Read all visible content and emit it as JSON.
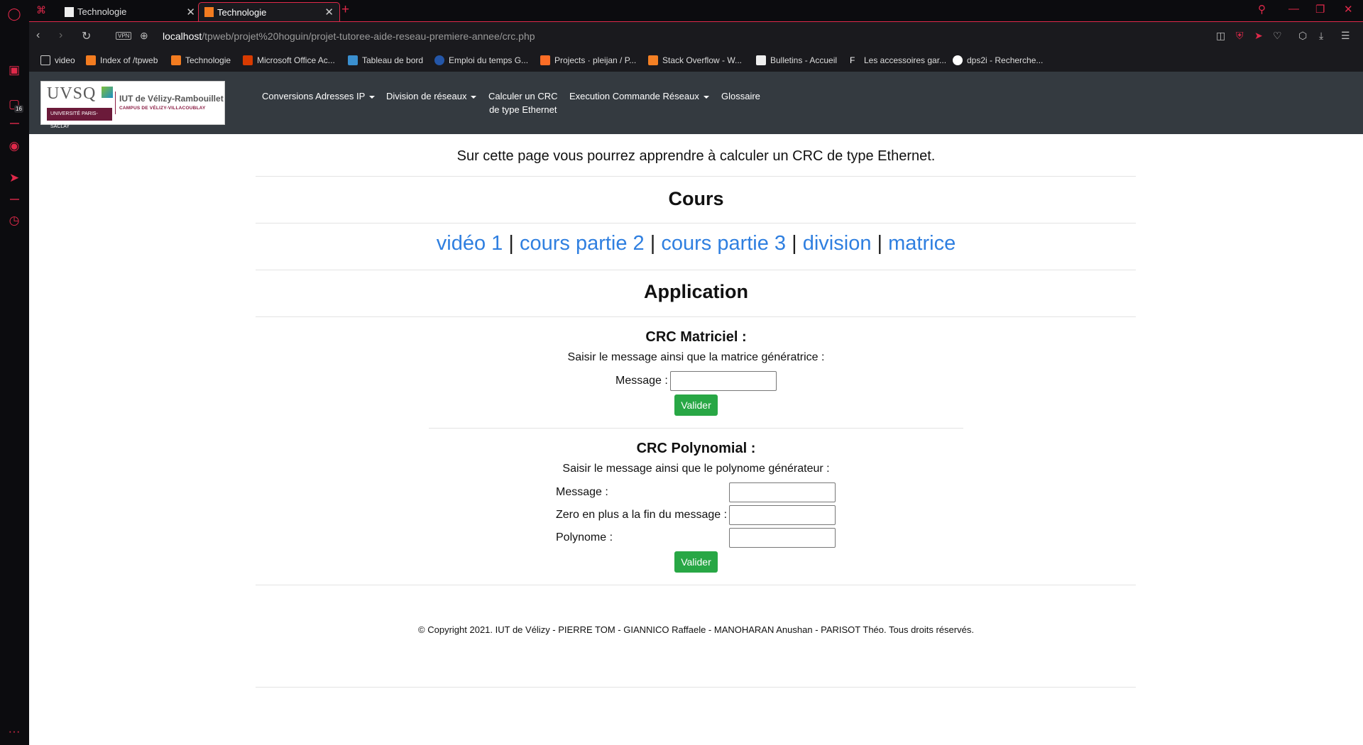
{
  "browser": {
    "tabs": [
      {
        "title": "Technologie",
        "active": false
      },
      {
        "title": "Technologie",
        "active": true
      }
    ],
    "url_host": "localhost",
    "url_path": "/tpweb/projet%20hoguin/projet-tutoree-aide-reseau-premiere-annee/crc.php",
    "vpn_label": "VPN",
    "sidebar_badge": "16",
    "bookmarks": [
      {
        "label": "video",
        "icon": "folder-icon"
      },
      {
        "label": "Index of /tpweb",
        "icon": "xampp-icon"
      },
      {
        "label": "Technologie",
        "icon": "xampp-icon"
      },
      {
        "label": "Microsoft Office Ac...",
        "icon": "office-icon"
      },
      {
        "label": "Tableau de bord",
        "icon": "dashboard-icon"
      },
      {
        "label": "Emploi du temps G...",
        "icon": "globe-icon"
      },
      {
        "label": "Projects · pleijan / P...",
        "icon": "gitlab-icon"
      },
      {
        "label": "Stack Overflow - W...",
        "icon": "stackoverflow-icon"
      },
      {
        "label": "Bulletins - Accueil",
        "icon": "document-icon"
      },
      {
        "label": "Les accessoires gar...",
        "icon": "f-icon"
      },
      {
        "label": "dps2i - Recherche...",
        "icon": "google-icon"
      }
    ],
    "accent_color": "#e0294a"
  },
  "site": {
    "logo": {
      "brand": "UVSQ",
      "institute": "IUT de Vélizy-Rambouillet",
      "campus": "CAMPUS DE VÉLIZY-VILLACOUBLAY",
      "university": "UNIVERSITÉ PARIS-SACLAY"
    },
    "nav": {
      "conversions": "Conversions Adresses IP",
      "division": "Division de réseaux",
      "crc_line1": "Calculer un CRC",
      "crc_line2": "de type Ethernet",
      "execution": "Execution Commande Réseaux",
      "glossaire": "Glossaire"
    },
    "intro": "Sur cette page vous pourrez apprendre à calculer un CRC de type Ethernet.",
    "cours_title": "Cours",
    "links": [
      "vidéo 1",
      "cours partie 2",
      "cours partie 3",
      "division",
      "matrice"
    ],
    "link_separator": "|",
    "application_title": "Application",
    "matriciel": {
      "title": "CRC Matriciel :",
      "description": "Saisir le message ainsi que la matrice génératrice :",
      "message_label": "Message :",
      "submit": "Valider"
    },
    "polynomial": {
      "title": "CRC Polynomial :",
      "description": "Saisir le message ainsi que le polynome générateur :",
      "message_label": "Message :",
      "zero_label": "Zero en plus a la fin du message :",
      "polynome_label": "Polynome :",
      "submit": "Valider"
    },
    "footer": "© Copyright 2021. IUT de Vélizy - PIERRE TOM - GIANNICO Raffaele - MANOHARAN Anushan - PARISOT Théo. Tous droits réservés.",
    "colors": {
      "navbar": "#343a40",
      "link": "#2f7fe0",
      "button": "#28a745"
    }
  }
}
